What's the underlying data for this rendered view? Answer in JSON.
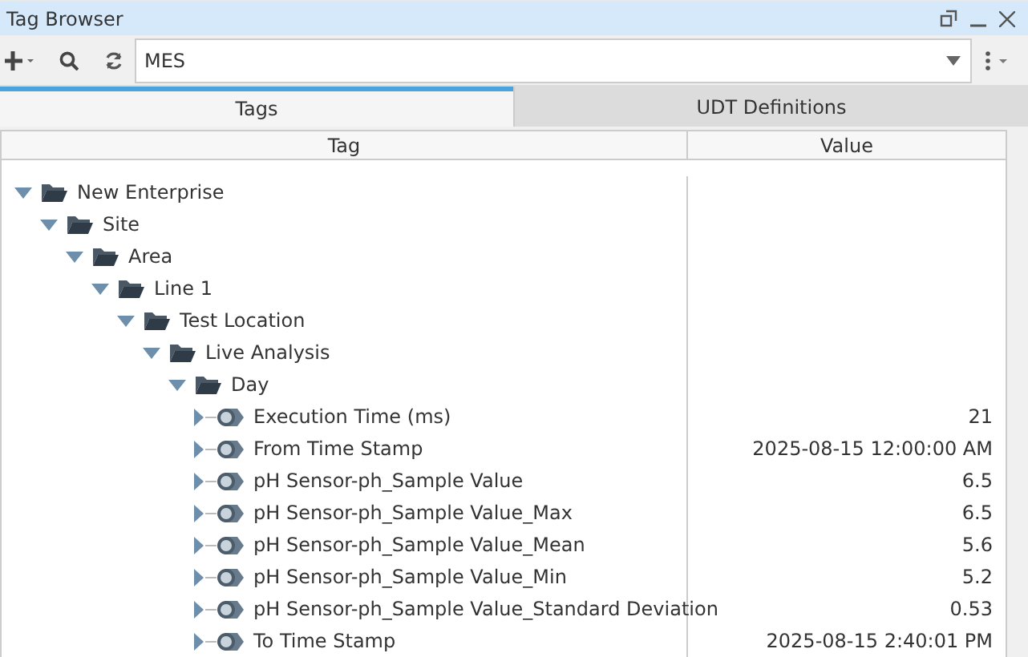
{
  "window": {
    "title": "Tag Browser"
  },
  "search": {
    "value": "MES"
  },
  "tabs": [
    {
      "label": "Tags",
      "selected": true
    },
    {
      "label": "UDT Definitions",
      "selected": false
    }
  ],
  "table": {
    "columns": [
      "Tag",
      "Value"
    ],
    "tree": [
      {
        "kind": "folder",
        "label": "New Enterprise",
        "expanded": true,
        "children": [
          {
            "kind": "folder",
            "label": "Site",
            "expanded": true,
            "children": [
              {
                "kind": "folder",
                "label": "Area",
                "expanded": true,
                "children": [
                  {
                    "kind": "folder",
                    "label": "Line 1",
                    "expanded": true,
                    "children": [
                      {
                        "kind": "folder",
                        "label": "Test Location",
                        "expanded": true,
                        "children": [
                          {
                            "kind": "folder",
                            "label": "Live Analysis",
                            "expanded": true,
                            "children": [
                              {
                                "kind": "folder",
                                "label": "Day",
                                "expanded": true,
                                "children": [
                                  {
                                    "kind": "tag",
                                    "label": "Execution Time (ms)",
                                    "value": "21",
                                    "expanded": false
                                  },
                                  {
                                    "kind": "tag",
                                    "label": "From Time Stamp",
                                    "value": "2025-08-15 12:00:00 AM",
                                    "expanded": false
                                  },
                                  {
                                    "kind": "tag",
                                    "label": "pH Sensor-ph_Sample Value",
                                    "value": "6.5",
                                    "expanded": false
                                  },
                                  {
                                    "kind": "tag",
                                    "label": "pH Sensor-ph_Sample Value_Max",
                                    "value": "6.5",
                                    "expanded": false
                                  },
                                  {
                                    "kind": "tag",
                                    "label": "pH Sensor-ph_Sample Value_Mean",
                                    "value": "5.6",
                                    "expanded": false
                                  },
                                  {
                                    "kind": "tag",
                                    "label": "pH Sensor-ph_Sample Value_Min",
                                    "value": "5.2",
                                    "expanded": false
                                  },
                                  {
                                    "kind": "tag",
                                    "label": "pH Sensor-ph_Sample Value_Standard Deviation",
                                    "value": "0.53",
                                    "expanded": false
                                  },
                                  {
                                    "kind": "tag",
                                    "label": "To Time Stamp",
                                    "value": "2025-08-15 2:40:01 PM",
                                    "expanded": false
                                  }
                                ]
                              }
                            ]
                          }
                        ]
                      }
                    ]
                  }
                ]
              }
            ]
          }
        ]
      }
    ]
  }
}
